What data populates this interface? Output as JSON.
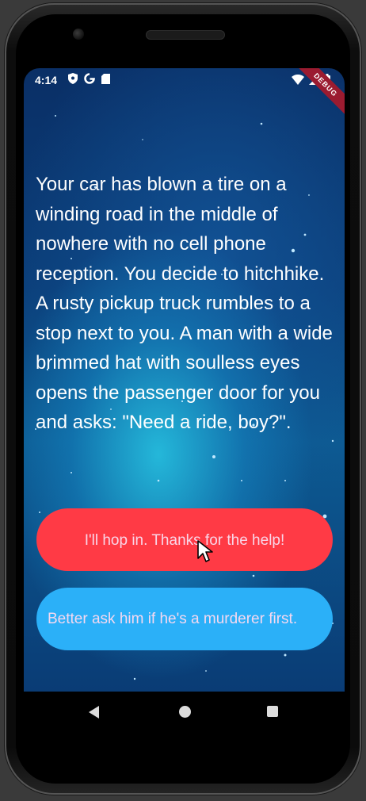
{
  "status_bar": {
    "time": "4:14",
    "icons": [
      "shield-icon",
      "google-g-icon",
      "sd-card-icon"
    ],
    "right_icons": [
      "wifi-icon",
      "cellular-signal-icon",
      "battery-icon"
    ]
  },
  "debug_banner": "DEBUG",
  "story": {
    "text": "Your car has blown a tire on a winding road in the middle of nowhere with no cell phone reception. You decide to hitchhike. A rusty pickup truck rumbles to a stop next to you. A man with a wide brimmed hat with soulless eyes opens the passenger door for you and asks: \"Need a ride, boy?\"."
  },
  "choices": [
    {
      "label": "I'll hop in. Thanks for the help!",
      "color": "#ff3a45"
    },
    {
      "label": "Better ask him if he's a murderer first.",
      "color": "#2bb0f8"
    }
  ],
  "navigation": [
    "back-icon",
    "home-icon",
    "recents-icon"
  ]
}
